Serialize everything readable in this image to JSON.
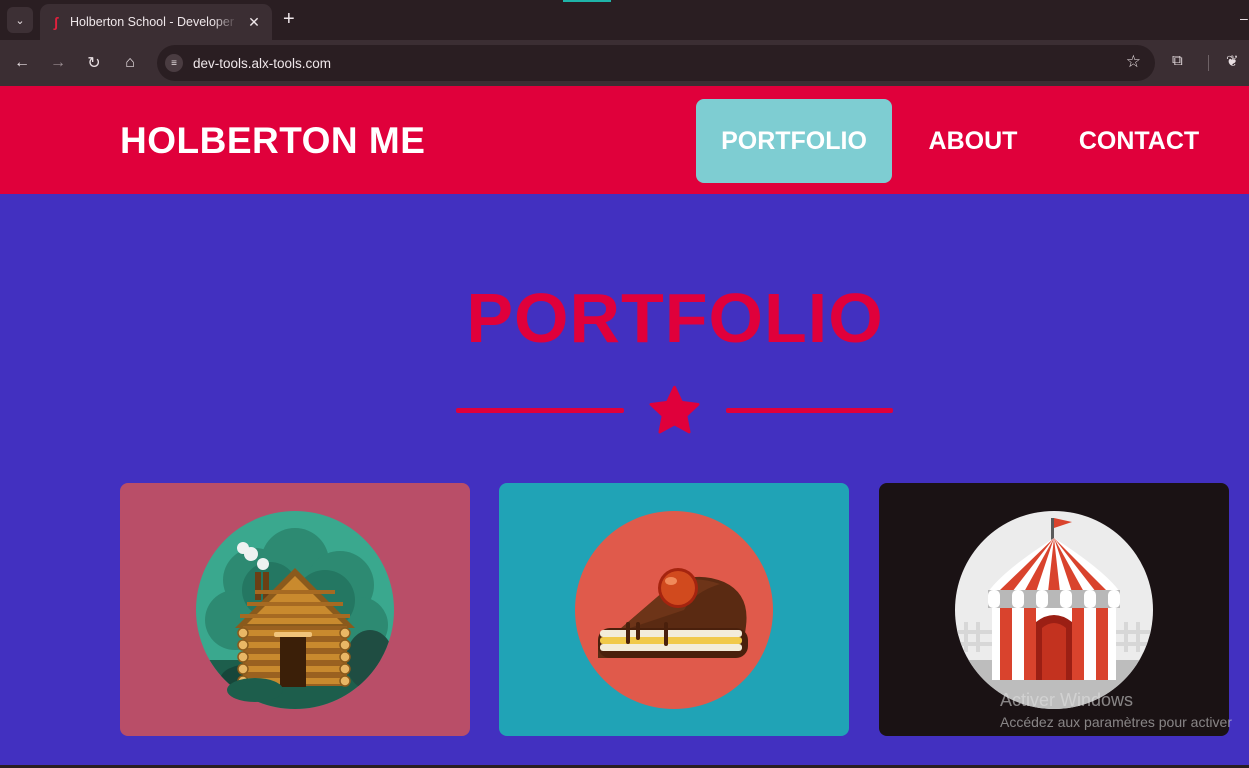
{
  "browser": {
    "tab_title": "Holberton School - Developer tools",
    "url": "dev-tools.alx-tools.com"
  },
  "site": {
    "brand": "HOLBERTON ME",
    "nav": [
      {
        "label": "PORTFOLIO",
        "active": true
      },
      {
        "label": "ABOUT",
        "active": false
      },
      {
        "label": "CONTACT",
        "active": false
      }
    ],
    "hero_title": "PORTFOLIO",
    "cards": [
      {
        "icon": "log-cabin-icon",
        "bg": "#b94e68",
        "circle": "#3aa88e"
      },
      {
        "icon": "cake-slice-icon",
        "bg": "#20a3b6",
        "circle": "#e05a4b"
      },
      {
        "icon": "circus-tent-icon",
        "bg": "#1a1214",
        "circle": "#ececec"
      }
    ]
  },
  "watermark": {
    "line1": "Activer Windows",
    "line2": "Accédez aux paramètres pour activer"
  },
  "colors": {
    "brand_red": "#e0003b",
    "page_bg": "#4230c0",
    "active_nav_bg": "#7ecdd2"
  }
}
